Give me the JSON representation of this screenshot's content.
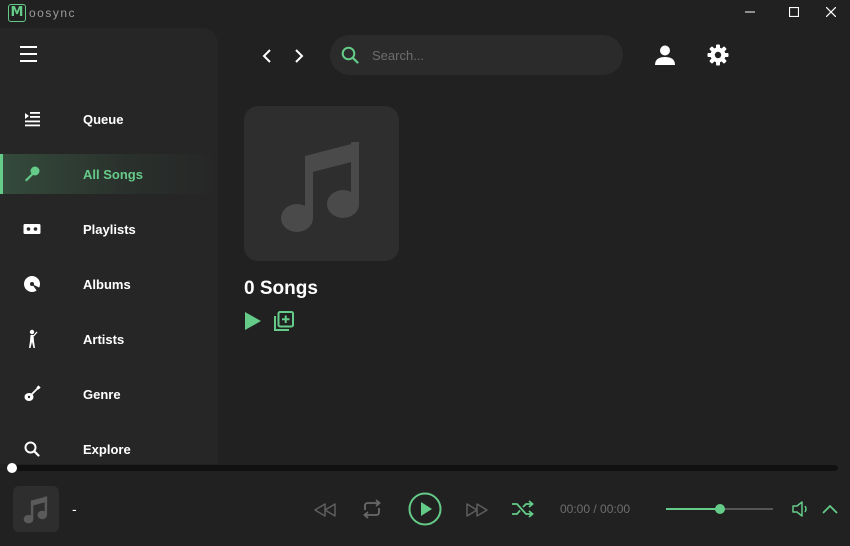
{
  "app": {
    "logo_letter": "M",
    "title": "oosync",
    "accent_color": "#65cb88"
  },
  "window_controls": [
    {
      "name": "minimize-icon"
    },
    {
      "name": "maximize-icon"
    },
    {
      "name": "close-icon"
    }
  ],
  "sidebar": {
    "menu_icon": "hamburger-icon",
    "items": [
      {
        "label": "Queue",
        "icon": "queue-icon",
        "active": false
      },
      {
        "label": "All Songs",
        "icon": "microphone-icon",
        "active": true
      },
      {
        "label": "Playlists",
        "icon": "cassette-icon",
        "active": false
      },
      {
        "label": "Albums",
        "icon": "disc-icon",
        "active": false
      },
      {
        "label": "Artists",
        "icon": "singer-icon",
        "active": false
      },
      {
        "label": "Genre",
        "icon": "guitar-icon",
        "active": false
      },
      {
        "label": "Explore",
        "icon": "search-icon",
        "active": false
      }
    ]
  },
  "topbar": {
    "back_icon": "chevron-left-icon",
    "forward_icon": "chevron-right-icon",
    "search_placeholder": "Search...",
    "account_icon": "user-icon",
    "settings_icon": "gear-icon"
  },
  "main": {
    "cover_icon": "music-note-icon",
    "song_count": "0 Songs",
    "play_all_icon": "play-icon",
    "add_to_queue_icon": "add-to-queue-icon"
  },
  "player": {
    "progress": 0,
    "song_title": "-",
    "time": "00:00 / 00:00",
    "volume": 0.5,
    "controls": [
      "rewind-icon",
      "repeat-icon",
      "play-icon",
      "fast-forward-icon",
      "shuffle-icon"
    ],
    "volume_icon": "volume-icon",
    "expand_icon": "chevron-up-icon"
  }
}
